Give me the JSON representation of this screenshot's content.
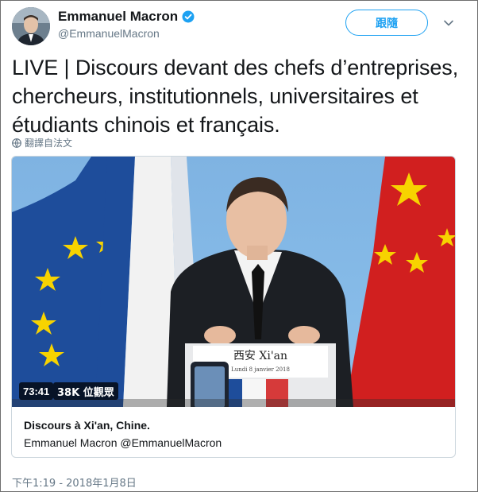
{
  "author": {
    "display_name": "Emmanuel Macron",
    "handle": "@EmmanuelMacron",
    "verified": true
  },
  "actions": {
    "follow_label": "跟隨"
  },
  "tweet": {
    "text": "LIVE | Discours devant des chefs d’entreprises, chercheurs, institutionnels, universitaires et étudiants chinois et français.",
    "translate_label": "翻譯自法文",
    "timestamp": "下午1:19 - 2018年1月8日"
  },
  "video": {
    "duration": "73:41",
    "views": "38K 位觀眾",
    "podium_text": "西安  Xi'an",
    "podium_subtext": "Lundi 8 janvier 2018"
  },
  "card": {
    "title": "Discours à Xi'an, Chine.",
    "subtitle": "Emmanuel Macron @EmmanuelMacron"
  },
  "colors": {
    "accent": "#1da1f2",
    "secondary_text": "#657786",
    "border": "#ccd6dd"
  },
  "icons": {
    "verified": "verified-badge-icon",
    "caret": "chevron-down-icon",
    "globe": "globe-icon"
  }
}
